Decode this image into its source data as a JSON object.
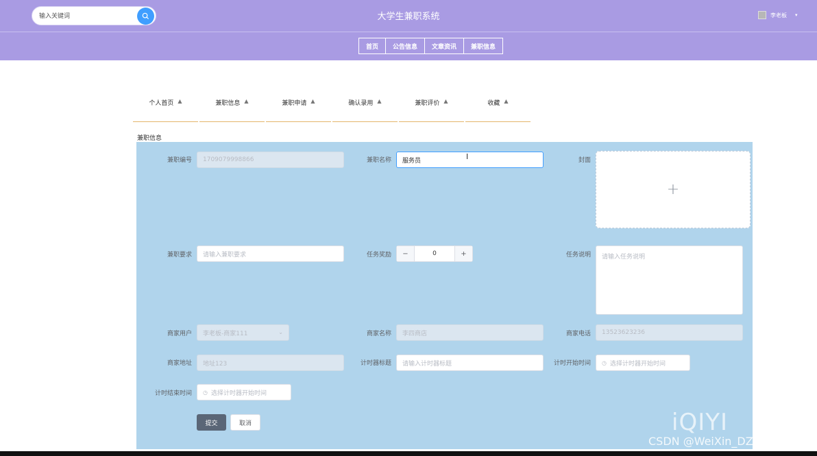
{
  "header": {
    "search_placeholder": "输入关键词",
    "title": "大学生兼职系统",
    "user_name": "李老板",
    "user_caret": "▾"
  },
  "topnav": [
    "首页",
    "公告信息",
    "文章资讯",
    "兼职信息"
  ],
  "tabs": [
    "个人首页",
    "兼职信息",
    "兼职申请",
    "确认录用",
    "兼职评价",
    "收藏"
  ],
  "section_title": "兼职信息",
  "form": {
    "job_no_label": "兼职编号",
    "job_no_value": "1709079998866",
    "job_name_label": "兼职名称",
    "job_name_value": "服务员",
    "cover_label": "封面",
    "cover_plus": "+",
    "requirement_label": "兼职要求",
    "requirement_placeholder": "请输入兼职要求",
    "reward_label": "任务奖励",
    "reward_value": "0",
    "reward_minus": "−",
    "reward_plus": "+",
    "task_desc_label": "任务说明",
    "task_desc_placeholder": "请输入任务说明",
    "merchant_user_label": "商家用户",
    "merchant_user_value": "李老板-商家111",
    "merchant_name_label": "商家名称",
    "merchant_name_value": "李四商店",
    "merchant_phone_label": "商家电话",
    "merchant_phone_value": "13523623236",
    "merchant_addr_label": "商家地址",
    "merchant_addr_value": "地址123",
    "timer_title_label": "计时器标题",
    "timer_title_placeholder": "请输入计时器标题",
    "timer_start_label": "计时开始时间",
    "timer_start_placeholder": "选择计时器开始时间",
    "timer_end_label": "计时结束时间",
    "timer_end_placeholder": "选择计时器开始时间",
    "submit_label": "提交",
    "cancel_label": "取消"
  },
  "watermark": {
    "logo": "iQIYI",
    "text": "CSDN @WeiXin_DZbishe"
  },
  "colors": {
    "header_bg": "#a99be3",
    "form_bg": "#b0d4ec",
    "accent": "#409eff",
    "tab_underline": "#e4b46b"
  }
}
